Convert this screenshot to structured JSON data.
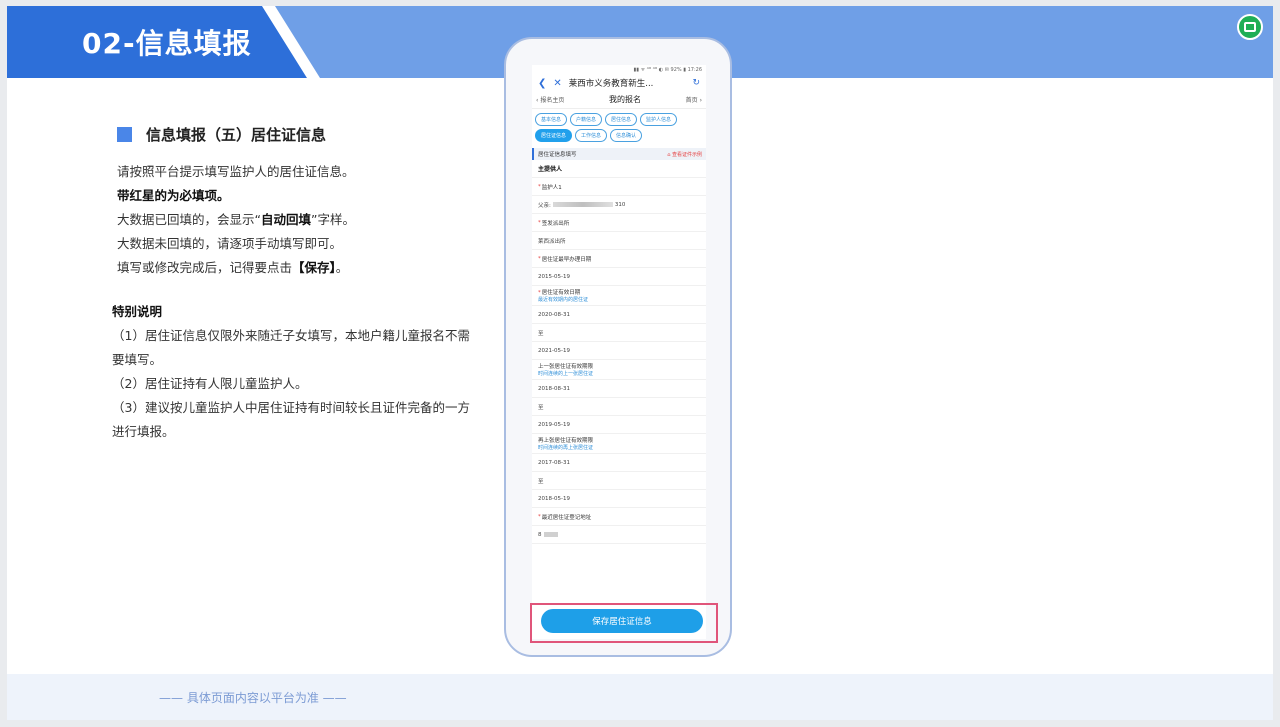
{
  "header": {
    "title": "02-信息填报"
  },
  "section": {
    "title": "信息填报（五）居住证信息"
  },
  "intro": {
    "line1": "请按照平台提示填写监护人的居住证信息。",
    "line2": "带红星的为必填项。",
    "line3_pre": "大数据已回填的，会显示“",
    "line3_bold": "自动回填",
    "line3_post": "”字样。",
    "line4": "大数据未回填的，请逐项手动填写即可。",
    "line5_pre": "填写或修改完成后，记得要点击",
    "line5_bold": "【保存】",
    "line5_post": "。"
  },
  "notes": {
    "title": "特别说明",
    "item1": "（1）居住证信息仅限外来随迁子女填写，本地户籍儿童报名不需要填写。",
    "item2": "（2）居住证持有人限儿童监护人。",
    "item3": "（3）建议按儿童监护人中居住证持有时间较长且证件完备的一方进行填报。"
  },
  "footer": {
    "text": "—— 具体页面内容以平台为准 ——"
  },
  "phone": {
    "status": "▮▮ ᯤ ⁴ᴳ ⁴ᴳ ◐ ✉ 92% ▮ 17:26",
    "nav_title": "莱西市义务教育新生...",
    "back_label": "报名主页",
    "page_title": "我的报名",
    "home_label": "首页",
    "tabs": [
      "基本信息",
      "户籍信息",
      "居住信息",
      "监护人信息",
      "居住证信息",
      "工作信息",
      "信息确认"
    ],
    "section_title": "居住证信息填写",
    "section_link": "查看证件示例",
    "fields": {
      "main_label": "主提供人",
      "guardian_label": "监护人1",
      "guardian_value_pre": "父亲:",
      "guardian_value_post": "310",
      "police_label": "签发派出所",
      "police_value": "莱西派出所",
      "earliest_label": "居住证最早办理日期",
      "earliest_value": "2015-05-19",
      "valid_label": "居住证有效日期",
      "valid_hint": "最近有效期内的居住证",
      "valid_start": "2020-08-31",
      "to1": "至",
      "valid_end": "2021-05-19",
      "prev_label": "上一张居住证有效期限",
      "prev_hint": "时间连续的上一张居住证",
      "prev_start": "2018-08-31",
      "to2": "至",
      "prev_end": "2019-05-19",
      "prev2_label": "再上张居住证有效期限",
      "prev2_hint": "时间连续的再上张居住证",
      "prev2_start": "2017-08-31",
      "to3": "至",
      "prev2_end": "2018-05-19",
      "addr_label": "最近居住证登记地址",
      "addr_value": "8"
    },
    "save_button": "保存居住证信息"
  }
}
